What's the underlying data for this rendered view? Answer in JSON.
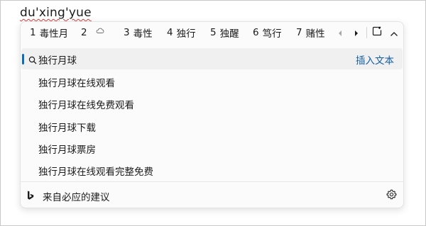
{
  "composition": "du'xing'yue",
  "candidates": [
    {
      "num": "1",
      "text": "毒性月"
    },
    {
      "num": "2",
      "text": ""
    },
    {
      "num": "3",
      "text": "毒性"
    },
    {
      "num": "4",
      "text": "独行"
    },
    {
      "num": "5",
      "text": "独醒"
    },
    {
      "num": "6",
      "text": "笃行"
    },
    {
      "num": "7",
      "text": "赌性"
    }
  ],
  "search": {
    "query": "独行月球",
    "insert_label": "插入文本"
  },
  "suggestions": [
    "独行月球在线观看",
    "独行月球在线免费观看",
    "独行月球下载",
    "独行月球票房",
    "独行月球在线观看完整免费"
  ],
  "footer": {
    "label": "来自必应的建议"
  },
  "colors": {
    "accent": "#0f6cbd",
    "link": "#115ea3",
    "spellcheck": "#d83b3b"
  },
  "icons": [
    "cloud-icon",
    "prev-page-icon",
    "next-page-icon",
    "sticker-icon",
    "collapse-icon",
    "search-icon",
    "bing-icon",
    "gear-icon"
  ]
}
